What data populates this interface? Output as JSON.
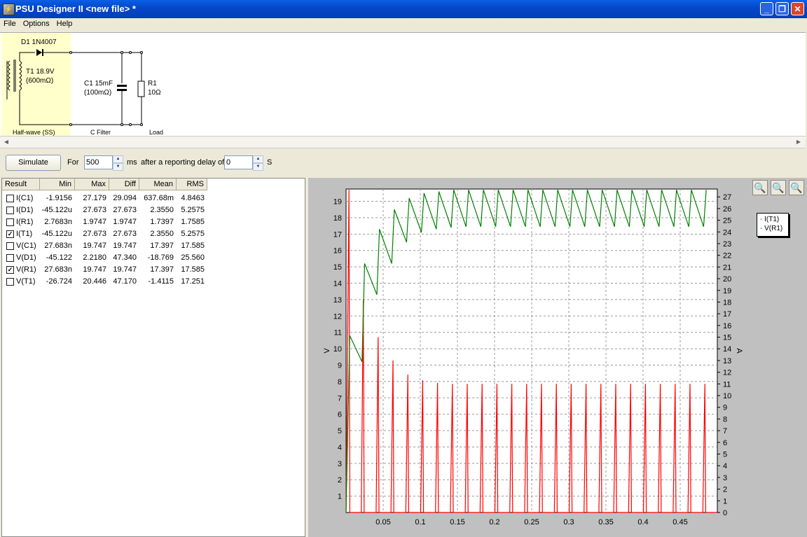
{
  "window": {
    "title": "PSU Designer II  <new file> *",
    "app_icon": "psu-designer-app-icon",
    "controls": {
      "minimize": "_",
      "maximize": "❐",
      "close": "✕"
    }
  },
  "menu": {
    "items": [
      "File",
      "Options",
      "Help"
    ]
  },
  "schematic": {
    "diode_label": "D1 1N4007",
    "transformer_label": "T1 18.9V",
    "transformer_res": "(600mΩ)",
    "cap_label": "C1 15mF",
    "cap_res": "(100mΩ)",
    "res_label": "R1",
    "res_value": "10Ω",
    "stage_rectifier": "Half-wave (SS)",
    "stage_filter": "C Filter",
    "stage_load": "Load"
  },
  "simulate": {
    "button_label": "Simulate",
    "for_label": "For",
    "duration_value": "500",
    "duration_unit": "ms",
    "delay_label": "after a reporting delay of",
    "delay_value": "0",
    "delay_unit": "S"
  },
  "results": {
    "columns": [
      "Result",
      "Min",
      "Max",
      "Diff",
      "Mean",
      "RMS"
    ],
    "rows": [
      {
        "checked": false,
        "name": "I(C1)",
        "min": "-1.9156",
        "max": "27.179",
        "diff": "29.094",
        "mean": "637.68m",
        "rms": "4.8463"
      },
      {
        "checked": false,
        "name": "I(D1)",
        "min": "-45.122u",
        "max": "27.673",
        "diff": "27.673",
        "mean": "2.3550",
        "rms": "5.2575"
      },
      {
        "checked": false,
        "name": "I(R1)",
        "min": "2.7683n",
        "max": "1.9747",
        "diff": "1.9747",
        "mean": "1.7397",
        "rms": "1.7585"
      },
      {
        "checked": true,
        "name": "I(T1)",
        "min": "-45.122u",
        "max": "27.673",
        "diff": "27.673",
        "mean": "2.3550",
        "rms": "5.2575"
      },
      {
        "checked": false,
        "name": "V(C1)",
        "min": "27.683n",
        "max": "19.747",
        "diff": "19.747",
        "mean": "17.397",
        "rms": "17.585"
      },
      {
        "checked": false,
        "name": "V(D1)",
        "min": "-45.122",
        "max": "2.2180",
        "diff": "47.340",
        "mean": "-18.769",
        "rms": "25.560"
      },
      {
        "checked": true,
        "name": "V(R1)",
        "min": "27.683n",
        "max": "19.747",
        "diff": "19.747",
        "mean": "17.397",
        "rms": "17.585"
      },
      {
        "checked": false,
        "name": "V(T1)",
        "min": "-26.724",
        "max": "20.446",
        "diff": "47.170",
        "mean": "-1.4115",
        "rms": "17.251"
      }
    ]
  },
  "zoom": {
    "icons": [
      "zoom-in-icon",
      "zoom-out-icon",
      "zoom-reset-icon"
    ]
  },
  "chart_data": {
    "type": "line",
    "xlabel": "",
    "ylabel": "V",
    "y2label": "A",
    "xlim": [
      0,
      0.5
    ],
    "ylim": [
      0,
      19.75
    ],
    "y2lim": [
      0,
      27.67
    ],
    "xticks": [
      "0.05",
      "0.1",
      "0.15",
      "0.2",
      "0.25",
      "0.3",
      "0.35",
      "0.4",
      "0.45"
    ],
    "yticks": [
      "1",
      "2",
      "3",
      "4",
      "5",
      "6",
      "7",
      "8",
      "9",
      "10",
      "11",
      "12",
      "13",
      "14",
      "15",
      "16",
      "17",
      "18",
      "19"
    ],
    "y2ticks": [
      "0",
      "1",
      "2",
      "3",
      "4",
      "5",
      "6",
      "7",
      "8",
      "9",
      "10",
      "11",
      "12",
      "13",
      "14",
      "15",
      "16",
      "17",
      "18",
      "19",
      "20",
      "21",
      "22",
      "23",
      "24",
      "25",
      "26",
      "27"
    ],
    "grid": true,
    "legend_position": "right",
    "series": [
      {
        "name": "I(T1)",
        "color": "#ff0000",
        "axis": "right",
        "period": 0.02,
        "pulse_peaks": [
          27.6,
          18.2,
          15.0,
          13.0,
          11.8,
          11.3,
          11.1,
          11.0,
          11.0,
          11.0,
          11.0,
          11.0,
          11.0,
          11.0,
          11.0,
          11.0,
          11.0,
          11.0,
          11.0,
          11.0,
          11.0,
          11.0,
          11.0,
          11.0,
          11.0
        ]
      },
      {
        "name": "V(R1)",
        "color": "#008000",
        "axis": "left",
        "period": 0.02,
        "cycle_peaks": [
          10.8,
          15.2,
          17.3,
          18.5,
          19.2,
          19.5,
          19.6,
          19.7,
          19.7,
          19.7,
          19.7,
          19.7,
          19.7,
          19.7,
          19.7,
          19.7,
          19.7,
          19.7,
          19.7,
          19.7,
          19.7,
          19.7,
          19.7,
          19.7,
          19.7
        ],
        "cycle_troughs": [
          9.2,
          13.3,
          15.2,
          16.5,
          17.1,
          17.3,
          17.4,
          17.45,
          17.45,
          17.45,
          17.45,
          17.45,
          17.45,
          17.45,
          17.45,
          17.45,
          17.45,
          17.45,
          17.45,
          17.45,
          17.45,
          17.45,
          17.45,
          17.45,
          17.5
        ]
      }
    ]
  }
}
